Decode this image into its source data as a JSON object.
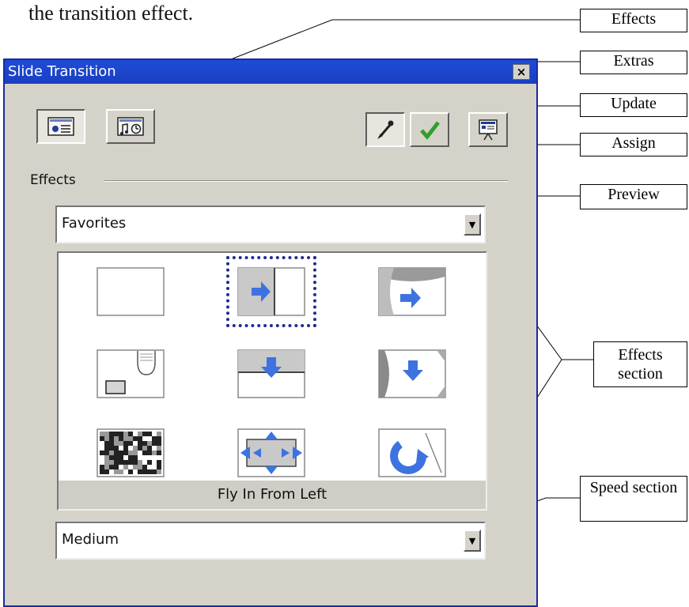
{
  "intro_text": "the transition effect.",
  "callouts": {
    "effects": "Effects",
    "extras": "Extras",
    "update": "Update",
    "assign": "Assign",
    "preview": "Preview",
    "effects_section": "Effects section",
    "speed_section": "Speed section"
  },
  "dialog": {
    "title": "Slide Transition",
    "close_glyph": "×",
    "group_label": "Effects",
    "category_select": "Favorites",
    "selected_effect_caption": "Fly In From Left",
    "speed_select": "Medium",
    "effects": [
      "none-effect-icon",
      "fly-in-from-left-icon",
      "roll-from-left-icon",
      "blinds-icon",
      "fly-in-from-top-icon",
      "roll-from-top-icon",
      "dissolve-icon",
      "spiral-arrows-icon",
      "rotate-icon"
    ],
    "selected_index": 1
  },
  "colors": {
    "title_bar": "#1e4bd8",
    "arrow_blue": "#3d73e0",
    "selection_border": "#1f2c90"
  }
}
